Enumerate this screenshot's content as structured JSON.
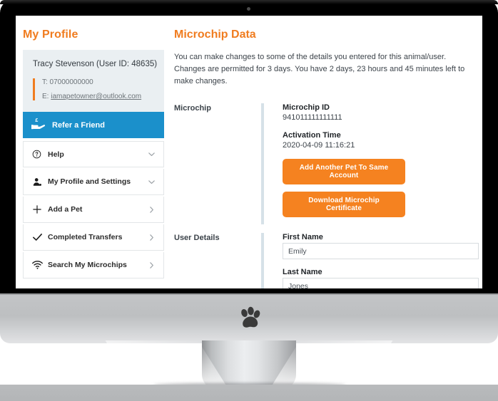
{
  "device": {
    "camera_icon": "camera-dot",
    "logo_icon": "paw-print-logo"
  },
  "sidebar": {
    "title": "My Profile",
    "profile": {
      "name_line": "Tracy Stevenson (User ID: 48635)",
      "phone": "T: 07000000000",
      "email_prefix": "E: ",
      "email": "iamapetowner@outlook.com"
    },
    "refer": {
      "label": "Refer a Friend",
      "icon": "hand-holding-pound-icon",
      "bg_color": "#1b90cb"
    },
    "items": [
      {
        "label": "Help",
        "icon": "question-circle-icon",
        "arrow": "chevron-down-icon"
      },
      {
        "label": "My Profile and Settings",
        "icon": "user-icon",
        "arrow": "chevron-down-icon"
      },
      {
        "label": "Add a Pet",
        "icon": "plus-icon",
        "arrow": "chevron-right-icon"
      },
      {
        "label": "Completed Transfers",
        "icon": "check-icon",
        "arrow": "chevron-right-icon"
      },
      {
        "label": "Search My Microchips",
        "icon": "signal-icon",
        "arrow": "chevron-right-icon"
      }
    ]
  },
  "main": {
    "title": "Microchip Data",
    "intro": "You can make changes to some of the details you entered for this animal/user. Changes are permitted for 3 days. You have 2 days, 23 hours and 45 minutes left to make changes.",
    "microchip_section": {
      "label": "Microchip",
      "id_label": "Microchip ID",
      "id_value": "941011111111111",
      "activation_label": "Activation Time",
      "activation_value": "2020-04-09 11:16:21",
      "add_pet_button": "Add Another Pet To Same Account",
      "download_button": "Download Microchip Certificate"
    },
    "user_section": {
      "label": "User Details",
      "first_name_label": "First Name",
      "first_name_value": "Emily",
      "last_name_label": "Last Name",
      "last_name_value": "Jones"
    }
  },
  "colors": {
    "accent_orange": "#f07c1f",
    "button_orange": "#f58220",
    "refer_blue": "#1b90cb",
    "card_bg": "#eaeff2",
    "rule_blue": "#d6e1e8"
  }
}
